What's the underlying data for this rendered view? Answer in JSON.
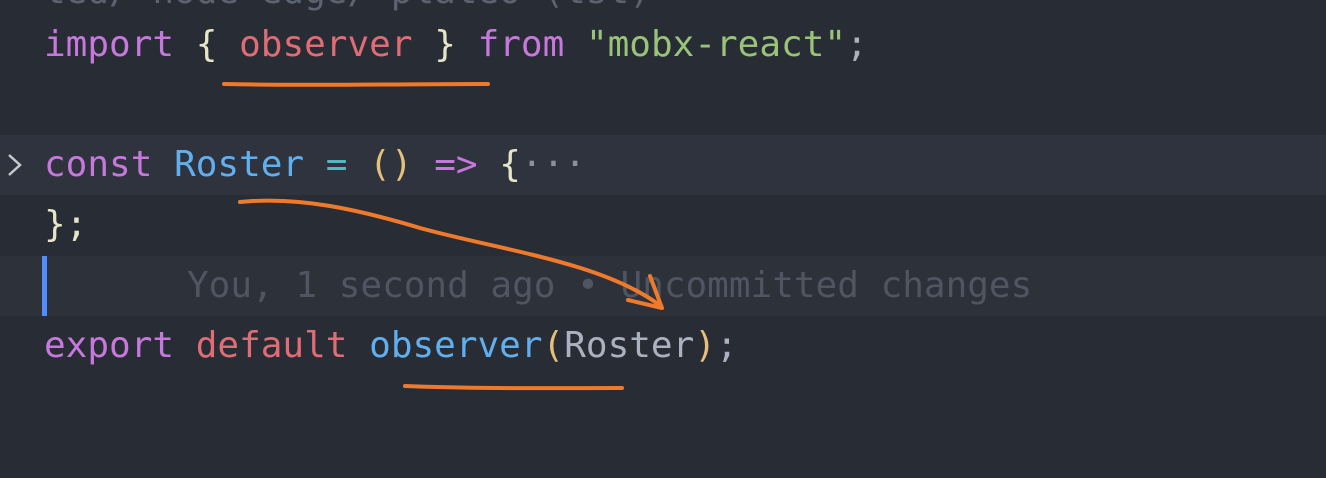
{
  "editor": {
    "cut_line": "ted/ node edge/ plateo (tst)",
    "line_import": {
      "kw_import": "import",
      "brace_open": "{",
      "name": "observer",
      "brace_close": "}",
      "kw_from": "from",
      "module": "\"mobx-react\"",
      "semi": ";"
    },
    "line_const": {
      "kw_const": "const",
      "name": "Roster",
      "eq": "=",
      "parens": "()",
      "arrow": "=>",
      "brace": "{",
      "ellipsis": "···"
    },
    "line_close": {
      "text": "};"
    },
    "blame": {
      "text": "You, 1 second ago • Uncommitted changes"
    },
    "line_export": {
      "kw_export": "export",
      "kw_default": "default",
      "func": "observer",
      "paren_open": "(",
      "arg": "Roster",
      "paren_close": ")",
      "semi": ";"
    }
  },
  "colors": {
    "background": "#282c34",
    "keyword": "#c678dd",
    "variable": "#e06c75",
    "string": "#98c379",
    "function": "#61afef",
    "annotation": "#f07a2c",
    "change_marker": "#528bff"
  },
  "icons": {
    "fold": "chevron-right-icon"
  }
}
